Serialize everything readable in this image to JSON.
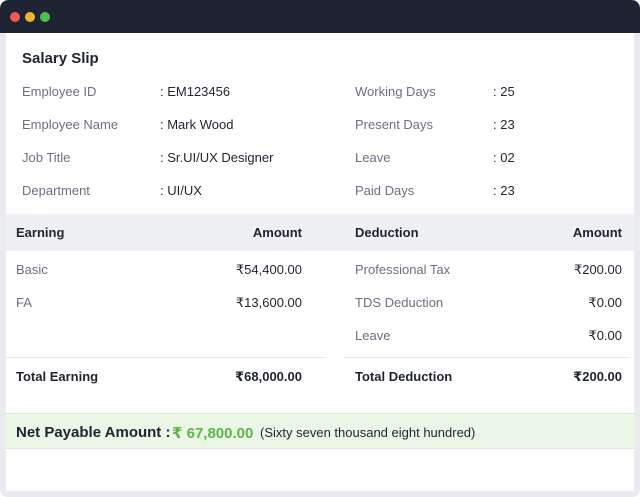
{
  "window": {
    "controls": [
      "close",
      "minimize",
      "maximize"
    ],
    "colors": {
      "close": "#ed5a56",
      "minimize": "#f1b331",
      "maximize": "#4fbf55"
    }
  },
  "slip": {
    "title": "Salary Slip",
    "employee": {
      "id_label": "Employee ID",
      "id_value": ": EM123456",
      "name_label": "Employee Name",
      "name_value": ": Mark Wood",
      "title_label": "Job Title",
      "title_value": ": Sr.UI/UX Designer",
      "dept_label": "Department",
      "dept_value": ": UI/UX"
    },
    "attendance": {
      "working_label": "Working Days",
      "working_value": ": 25",
      "present_label": "Present Days",
      "present_value": ": 23",
      "leave_label": "Leave",
      "leave_value": ": 02",
      "paid_label": "Paid Days",
      "paid_value": ": 23"
    }
  },
  "earnings": {
    "header": "Earning",
    "amount_header": "Amount",
    "items": [
      {
        "label": "Basic",
        "amount": "₹54,400.00"
      },
      {
        "label": "FA",
        "amount": "₹13,600.00"
      }
    ],
    "total_label": "Total Earning",
    "total_amount": "₹68,000.00"
  },
  "deductions": {
    "header": "Deduction",
    "amount_header": "Amount",
    "items": [
      {
        "label": "Professional Tax",
        "amount": "₹200.00"
      },
      {
        "label": "TDS Deduction",
        "amount": "₹0.00"
      },
      {
        "label": "Leave",
        "amount": "₹0.00"
      }
    ],
    "total_label": "Total Deduction",
    "total_amount": "₹200.00"
  },
  "net": {
    "label": "Net Payable Amount :",
    "amount": "₹ 67,800.00",
    "words": "(Sixty seven thousand eight hundred)",
    "accent_color": "#5fb34a"
  }
}
